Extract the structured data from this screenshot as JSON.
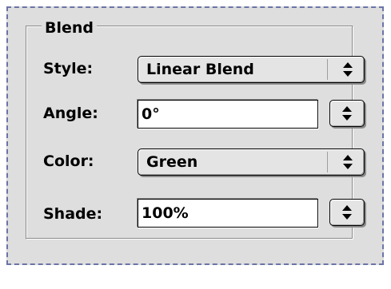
{
  "group": {
    "title": "Blend"
  },
  "style": {
    "label": "Style:",
    "value": "Linear Blend",
    "arrow_icon": "updown-arrows-icon"
  },
  "angle": {
    "label": "Angle:",
    "value": "0°",
    "stepper_icon": "updown-arrows-icon"
  },
  "color": {
    "label": "Color:",
    "value": "Green",
    "arrow_icon": "updown-arrows-icon"
  },
  "shade": {
    "label": "Shade:",
    "value": "100%",
    "stepper_icon": "updown-arrows-icon"
  },
  "colors": {
    "panel_bg": "#dedede",
    "border_dash": "#6b74a6"
  }
}
